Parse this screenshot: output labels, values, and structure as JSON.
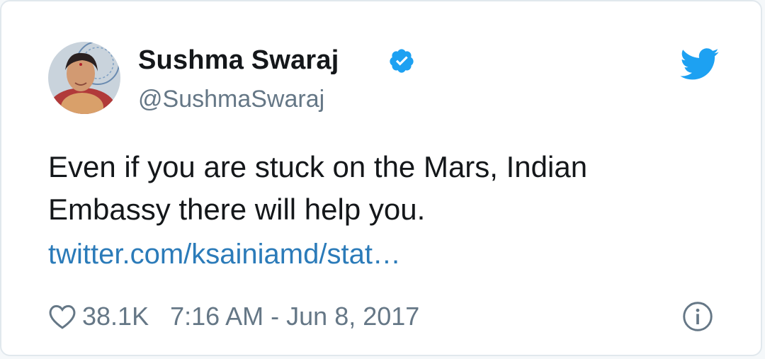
{
  "tweet": {
    "author": {
      "display_name": "Sushma Swaraj",
      "handle": "@SushmaSwaraj",
      "verified": true,
      "avatar_icon": "profile-photo"
    },
    "text_lines": [
      "Even if you are stuck on the Mars, Indian",
      "Embassy there will help you."
    ],
    "link": "twitter.com/ksainiamd/stat…",
    "likes": "38.1K",
    "timestamp": "7:16 AM - Jun 8, 2017",
    "icons": {
      "brand": "twitter-bird-icon",
      "verified": "verified-badge-icon",
      "like": "heart-icon",
      "info": "info-icon"
    }
  },
  "colors": {
    "brand_blue": "#1da1f2",
    "link": "#2b7bb9",
    "text": "#14171a",
    "secondary_text": "#657786",
    "border": "#e1e8ed"
  }
}
